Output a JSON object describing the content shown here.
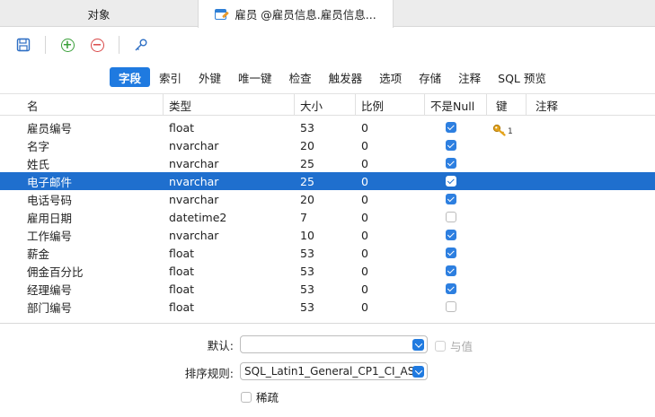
{
  "tabs": [
    {
      "label": "对象"
    },
    {
      "label": "雇员 @雇员信息.雇员信息..."
    }
  ],
  "subtabs": [
    "字段",
    "索引",
    "外键",
    "唯一键",
    "检查",
    "触发器",
    "选项",
    "存储",
    "注释",
    "SQL 预览"
  ],
  "grid": {
    "columns": [
      "名",
      "类型",
      "大小",
      "比例",
      "不是Null",
      "键",
      "注释"
    ],
    "rows": [
      {
        "name": "雇员编号",
        "type": "float",
        "size": "53",
        "scale": "0",
        "notnull": true,
        "key": "1"
      },
      {
        "name": "名字",
        "type": "nvarchar",
        "size": "20",
        "scale": "0",
        "notnull": true,
        "key": ""
      },
      {
        "name": "姓氏",
        "type": "nvarchar",
        "size": "25",
        "scale": "0",
        "notnull": true,
        "key": ""
      },
      {
        "name": "电子邮件",
        "type": "nvarchar",
        "size": "25",
        "scale": "0",
        "notnull": true,
        "key": "",
        "selected": true
      },
      {
        "name": "电话号码",
        "type": "nvarchar",
        "size": "20",
        "scale": "0",
        "notnull": true,
        "key": ""
      },
      {
        "name": "雇用日期",
        "type": "datetime2",
        "size": "7",
        "scale": "0",
        "notnull": false,
        "key": ""
      },
      {
        "name": "工作编号",
        "type": "nvarchar",
        "size": "10",
        "scale": "0",
        "notnull": true,
        "key": ""
      },
      {
        "name": "薪金",
        "type": "float",
        "size": "53",
        "scale": "0",
        "notnull": true,
        "key": ""
      },
      {
        "name": "佣金百分比",
        "type": "float",
        "size": "53",
        "scale": "0",
        "notnull": true,
        "key": ""
      },
      {
        "name": "经理编号",
        "type": "float",
        "size": "53",
        "scale": "0",
        "notnull": true,
        "key": ""
      },
      {
        "name": "部门编号",
        "type": "float",
        "size": "53",
        "scale": "0",
        "notnull": false,
        "key": ""
      }
    ]
  },
  "form": {
    "default_label": "默认:",
    "default_value": "",
    "with_value_label": "与值",
    "collation_label": "排序规则:",
    "collation_value": "SQL_Latin1_General_CP1_CI_AS",
    "sparse_label": "稀疏"
  },
  "colors": {
    "accent": "#1f7ae0",
    "selected_row": "#1f6fce"
  }
}
